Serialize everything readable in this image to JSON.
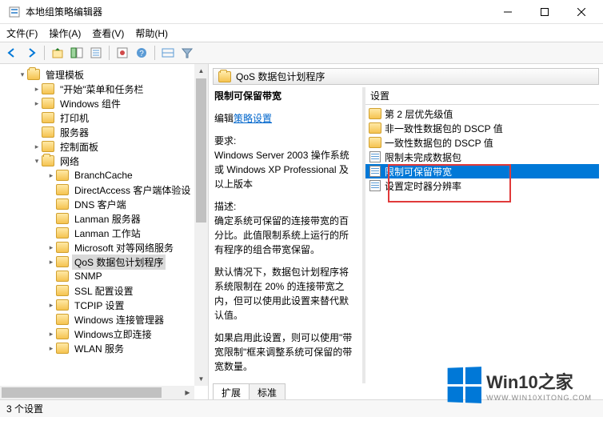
{
  "window": {
    "title": "本地组策略编辑器"
  },
  "menu": {
    "file": "文件(F)",
    "action": "操作(A)",
    "view": "查看(V)",
    "help": "帮助(H)"
  },
  "tree": {
    "root": "管理模板",
    "items": [
      "\"开始\"菜单和任务栏",
      "Windows 组件",
      "打印机",
      "服务器",
      "控制面板"
    ],
    "network": "网络",
    "netitems": [
      "BranchCache",
      "DirectAccess 客户端体验设",
      "DNS 客户端",
      "Lanman 服务器",
      "Lanman 工作站",
      "Microsoft 对等网络服务",
      "QoS 数据包计划程序",
      "SNMP",
      "SSL 配置设置",
      "TCPIP 设置",
      "Windows 连接管理器",
      "Windows立即连接",
      "WLAN 服务"
    ]
  },
  "header": {
    "title": "QoS 数据包计划程序"
  },
  "desc": {
    "policyname": "限制可保留带宽",
    "edit_prefix": "编辑",
    "edit_link": "策略设置",
    "req_label": "要求:",
    "req_body": "Windows Server 2003 操作系统或 Windows XP Professional 及以上版本",
    "desc_label": "描述:",
    "desc_body": "确定系统可保留的连接带宽的百分比。此值限制系统上运行的所有程序的组合带宽保留。",
    "p2": "默认情况下，数据包计划程序将系统限制在 20% 的连接带宽之内，但可以使用此设置来替代默认值。",
    "p3": "如果启用此设置，则可以使用\"带宽限制\"框来调整系统可保留的带宽数量。"
  },
  "list": {
    "col": "设置",
    "items": [
      {
        "name": "第 2 层优先级值",
        "type": "folder"
      },
      {
        "name": "非一致性数据包的 DSCP 值",
        "type": "folder"
      },
      {
        "name": "一致性数据包的 DSCP 值",
        "type": "folder"
      },
      {
        "name": "限制未完成数据包",
        "type": "policy"
      },
      {
        "name": "限制可保留带宽",
        "type": "policy",
        "selected": true
      },
      {
        "name": "设置定时器分辨率",
        "type": "policy"
      }
    ]
  },
  "tabs": {
    "extended": "扩展",
    "standard": "标准"
  },
  "status": "3 个设置",
  "logo": {
    "main": "Win10之家",
    "sub": "WWW.WIN10XITONG.COM"
  }
}
